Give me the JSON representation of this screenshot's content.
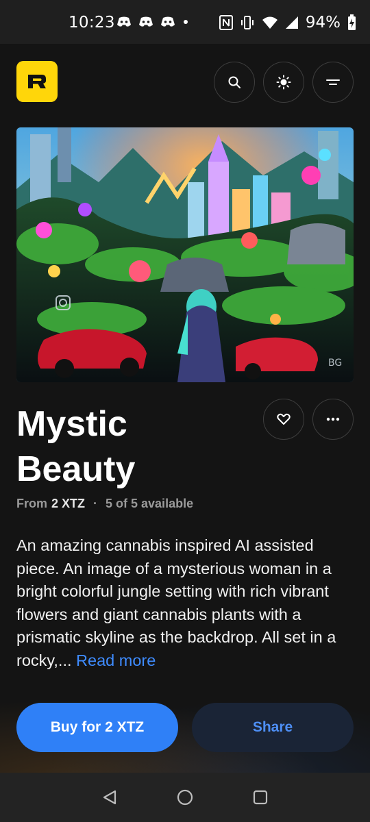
{
  "status_bar": {
    "time": "10:23",
    "battery": "94%",
    "notification_icons": [
      "discord-icon",
      "discord-icon",
      "discord-icon",
      "dot-icon"
    ],
    "system_icons": [
      "nfc-icon",
      "vibrate-icon",
      "wifi-icon",
      "signal-icon",
      "battery-charging-icon"
    ]
  },
  "header": {
    "logo_letter": "R",
    "logo_color": "#ffd60a",
    "buttons": [
      "search-icon",
      "brightness-icon",
      "menu-icon"
    ]
  },
  "artwork": {
    "watermark": "BG"
  },
  "item": {
    "title_line1": "Mystic",
    "title_line2": "Beauty",
    "from_label": "From",
    "price": "2 XTZ",
    "separator": "·",
    "availability": "5 of 5 available",
    "description": "An amazing cannabis inspired AI assisted piece. An image of a mysterious woman in a bright colorful jungle setting with rich vibrant flowers and giant cannabis plants with a prismatic skyline as the backdrop. All set in a rocky,...",
    "read_more": "Read more"
  },
  "actions": {
    "buy_label": "Buy for 2 XTZ",
    "share_label": "Share",
    "accent": "#2f80f7"
  },
  "nav": [
    "back-icon",
    "home-icon",
    "recents-icon"
  ]
}
